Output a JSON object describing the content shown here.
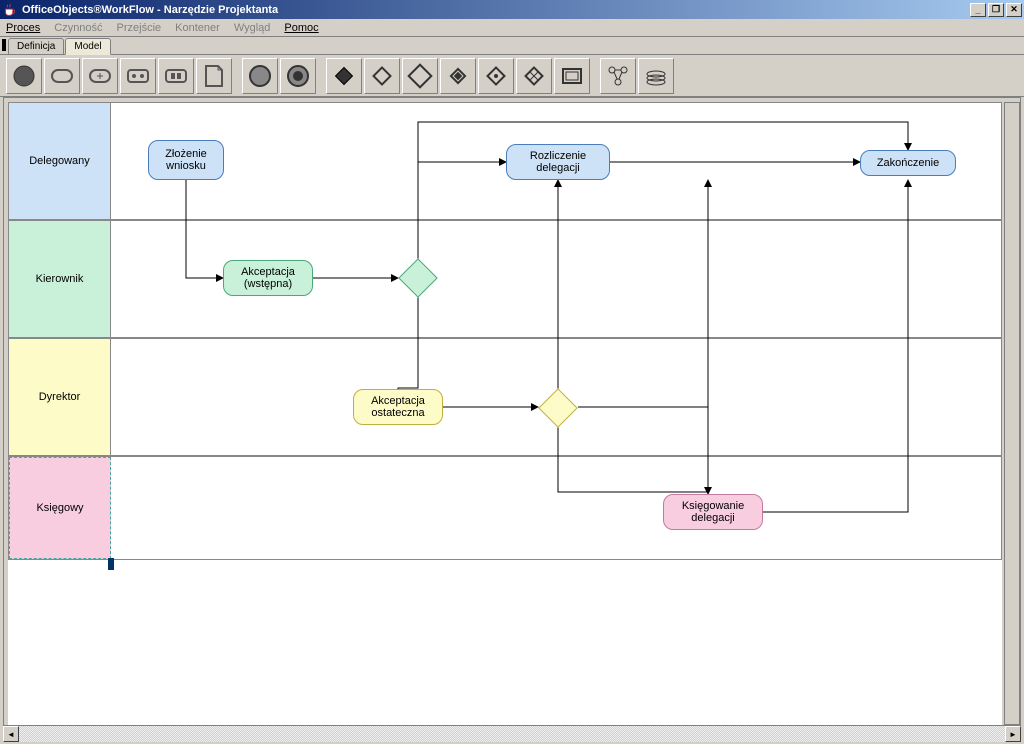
{
  "window": {
    "title": "OfficeObjects®WorkFlow - Narzędzie Projektanta"
  },
  "menu": {
    "items": [
      {
        "label": "Proces",
        "enabled": true
      },
      {
        "label": "Czynność",
        "enabled": false
      },
      {
        "label": "Przejście",
        "enabled": false
      },
      {
        "label": "Kontener",
        "enabled": false
      },
      {
        "label": "Wygląd",
        "enabled": false
      },
      {
        "label": "Pomoc",
        "enabled": true
      }
    ]
  },
  "tabs": {
    "items": [
      {
        "label": "Definicja",
        "active": false
      },
      {
        "label": "Model",
        "active": true
      }
    ]
  },
  "toolbar": {
    "tools": [
      "circle-dark",
      "rounded-rect",
      "rounded-rect-plus",
      "rect-pattern-1",
      "rect-pattern-2",
      "note",
      "circle-outline",
      "circle-filled",
      "diamond-dark",
      "diamond-light",
      "diamond-big",
      "diamond-small",
      "diamond-dot",
      "diamond-dot-2",
      "rect-double",
      "graph",
      "stack"
    ]
  },
  "swimlanes": [
    {
      "id": "delegowany",
      "label": "Delegowany",
      "color": "#cde2f7"
    },
    {
      "id": "kierownik",
      "label": "Kierownik",
      "color": "#c9f0d8"
    },
    {
      "id": "dyrektor",
      "label": "Dyrektor",
      "color": "#fdfbc7"
    },
    {
      "id": "ksiegowy",
      "label": "Księgowy",
      "color": "#f9cde0"
    }
  ],
  "nodes": {
    "zlozenie": {
      "label": "Złożenie wniosku",
      "lane": "delegowany",
      "type": "activity"
    },
    "rozliczenie": {
      "label": "Rozliczenie delegacji",
      "lane": "delegowany",
      "type": "activity"
    },
    "zakonczenie": {
      "label": "Zakończenie",
      "lane": "delegowany",
      "type": "activity"
    },
    "akceptacja_wstepna": {
      "label": "Akceptacja (wstępna)",
      "lane": "kierownik",
      "type": "activity"
    },
    "gateway1": {
      "label": "",
      "lane": "kierownik",
      "type": "gateway"
    },
    "akceptacja_ostateczna": {
      "label": "Akceptacja ostateczna",
      "lane": "dyrektor",
      "type": "activity"
    },
    "gateway2": {
      "label": "",
      "lane": "dyrektor",
      "type": "gateway"
    },
    "ksiegowanie": {
      "label": "Księgowanie delegacji",
      "lane": "ksiegowy",
      "type": "activity"
    }
  },
  "edges": [
    {
      "from": "zlozenie",
      "to": "akceptacja_wstepna"
    },
    {
      "from": "akceptacja_wstepna",
      "to": "gateway1"
    },
    {
      "from": "gateway1",
      "to": "rozliczenie"
    },
    {
      "from": "gateway1",
      "to": "akceptacja_ostateczna"
    },
    {
      "from": "gateway1",
      "to": "zakonczenie",
      "via": "top"
    },
    {
      "from": "akceptacja_ostateczna",
      "to": "gateway2"
    },
    {
      "from": "gateway2",
      "to": "rozliczenie"
    },
    {
      "from": "gateway2",
      "to": "zakonczenie"
    },
    {
      "from": "gateway2",
      "to": "ksiegowanie"
    },
    {
      "from": "ksiegowanie",
      "to": "zakonczenie"
    }
  ]
}
